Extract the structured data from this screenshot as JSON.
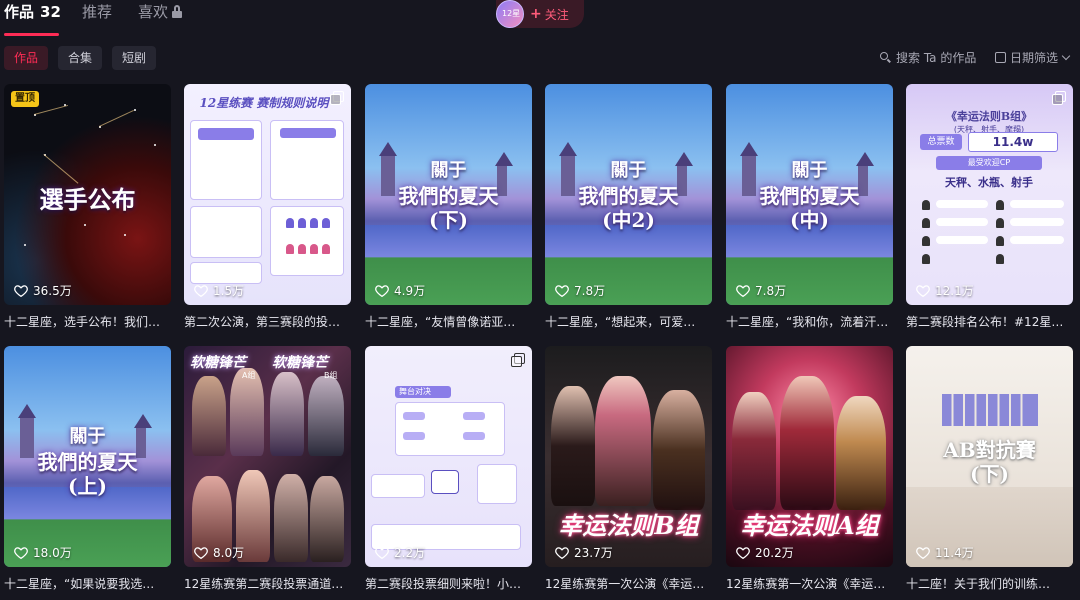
{
  "tabs": {
    "works_label": "作品",
    "works_count": "32",
    "recommend_label": "推荐",
    "likes_label": "喜欢"
  },
  "follow": {
    "label": "关注",
    "avatar_text": "12星"
  },
  "filters": {
    "chips": [
      "作品",
      "合集",
      "短剧"
    ],
    "search_placeholder": "搜索 Ta 的作品",
    "date_filter": "日期筛选"
  },
  "videos": [
    {
      "badge": "置顶",
      "title": "選手公布",
      "likes": "36.5万",
      "caption": "十二星座，选手公布！我们…"
    },
    {
      "title": "12星练赛 赛制规则说明",
      "likes": "1.5万",
      "caption": "第二次公演，第三赛段的投…",
      "multi": true
    },
    {
      "title_line1": "關于",
      "title_line2": "我們的夏天",
      "title_line3": "(下)",
      "likes": "4.9万",
      "caption": "十二星座，“友情曾像诺亚…"
    },
    {
      "title_line1": "關于",
      "title_line2": "我們的夏天",
      "title_line3": "(中2)",
      "likes": "7.8万",
      "caption": "十二星座，“想起来，可爱…"
    },
    {
      "title_line1": "關于",
      "title_line2": "我們的夏天",
      "title_line3": "(中)",
      "likes": "7.8万",
      "caption": "十二星座，“我和你，流着汗…"
    },
    {
      "head": "《幸运法则B组》",
      "subhead": "(天秤、射手、摩羯)",
      "total_label": "总票数",
      "total": "11.4w",
      "cp_label": "最受欢迎CP",
      "cp": "天秤、水瓶、射手",
      "likes": "12.1万",
      "caption": "第二赛段排名公布！#12星…",
      "multi": true
    },
    {
      "title_line1": "關于",
      "title_line2": "我們的夏天",
      "title_line3": "(上)",
      "likes": "18.0万",
      "caption": "十二星座，“如果说要我选…"
    },
    {
      "title": "软糖锋芒",
      "tag_a": "A组",
      "tag_b": "B组",
      "likes": "8.0万",
      "caption": "12星练赛第二赛段投票通道…"
    },
    {
      "title": "舞台对决",
      "likes": "2.2万",
      "caption": "第二赛段投票细则来啦！小…",
      "multi": true
    },
    {
      "title": "幸运法则B组",
      "likes": "23.7万",
      "caption": "12星练赛第一次公演《幸运…"
    },
    {
      "title": "幸运法则A组",
      "likes": "20.2万",
      "caption": "12星练赛第一次公演《幸运…"
    },
    {
      "title_line1": "AB對抗賽",
      "title_line2": "(下)",
      "likes": "11.4万",
      "caption": "十二座！关于我们的训练…"
    }
  ],
  "colors": {
    "accent": "#fe2c55",
    "background": "#16161f",
    "pin": "#f5c518"
  }
}
